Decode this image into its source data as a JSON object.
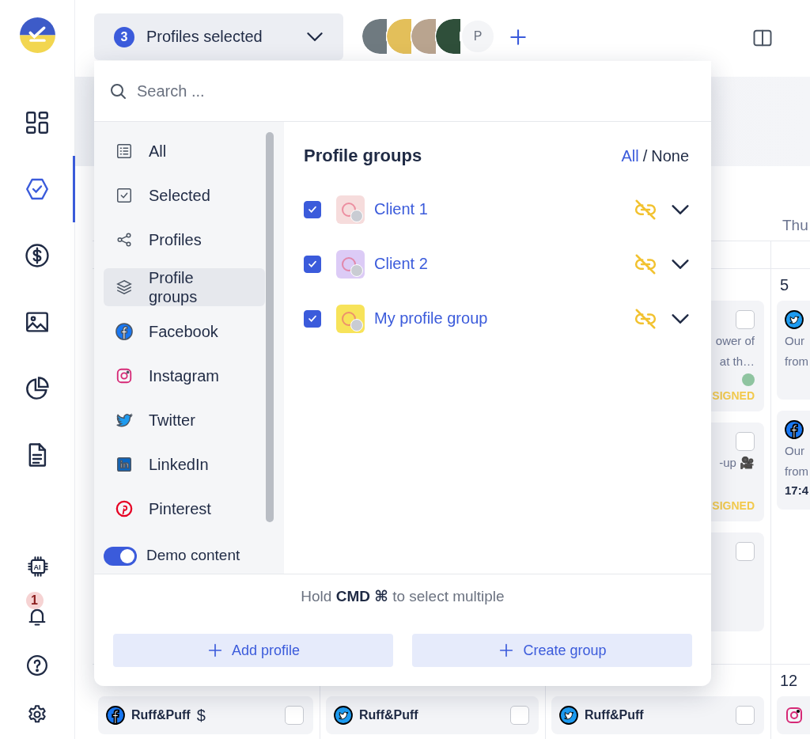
{
  "sidebar": {
    "items": [
      {
        "selected": false
      },
      {
        "selected": true
      },
      {
        "selected": false
      },
      {
        "selected": false
      },
      {
        "selected": false
      },
      {
        "selected": false
      }
    ],
    "ai_label": "AI",
    "notification_badge": "1"
  },
  "topbar": {
    "profile_selector": {
      "count": "3",
      "label": "Profiles selected",
      "expanded": true
    },
    "avatars": [
      {
        "kind": "photo"
      },
      {
        "kind": "photo"
      },
      {
        "kind": "photo"
      },
      {
        "kind": "photo"
      },
      {
        "kind": "initial",
        "text": "P"
      }
    ]
  },
  "dropdown": {
    "search": {
      "placeholder": "Search ..."
    },
    "categories": [
      {
        "label": "All",
        "selected": false
      },
      {
        "label": "Selected",
        "selected": false
      },
      {
        "label": "Profiles",
        "selected": false
      },
      {
        "label": "Profile groups",
        "selected": true
      },
      {
        "label": "Facebook",
        "selected": false
      },
      {
        "label": "Instagram",
        "selected": false
      },
      {
        "label": "Twitter",
        "selected": false
      },
      {
        "label": "LinkedIn",
        "selected": false
      },
      {
        "label": "Pinterest",
        "selected": false
      }
    ],
    "demo_toggle": {
      "label": "Demo content",
      "on": true
    },
    "heading": "Profile groups",
    "select_all": "All",
    "separator": "/",
    "select_none": "None",
    "groups": [
      {
        "name": "Client 1",
        "checked": true,
        "color": "#f6dcdc"
      },
      {
        "name": "Client 2",
        "checked": true,
        "color": "#dccbf6"
      },
      {
        "name": "My profile group",
        "checked": true,
        "color": "#f7e35a"
      }
    ],
    "hint": "Hold **CMD ⌘** to select multiple",
    "buttons": [
      {
        "label": "Add profile"
      },
      {
        "label": "Create group"
      }
    ]
  },
  "calendar": {
    "weekday": "Thu",
    "weeks": [
      {
        "days": [
          {
            "posts": [
              {
                "kind": "none",
                "checked": false,
                "lines": [
                  "ower of",
                  "at th…"
                ],
                "color": "#8fc4a0",
                "status": "SIGNED"
              },
              {
                "kind": "none",
                "checked": false,
                "lines": [
                  "-up 🎥"
                ],
                "status": "SIGNED"
              },
              {
                "kind": "none",
                "checked": false
              }
            ]
          },
          {
            "date": "5",
            "posts": [
              {
                "kind": "twitter",
                "lines": [
                  "Our",
                  "from"
                ]
              },
              {
                "kind": "facebook",
                "lines": [
                  "Our",
                  "from"
                ],
                "time": "17:4"
              }
            ]
          }
        ]
      },
      {
        "days": [
          {
            "posts": [
              {
                "kind": "facebook",
                "author": "Ruff&Puff",
                "extra": "$",
                "checked": false
              }
            ]
          },
          {
            "posts": [
              {
                "kind": "twitter",
                "author": "Ruff&Puff",
                "checked": false
              }
            ]
          },
          {
            "posts": [
              {
                "kind": "twitter",
                "author": "Ruff&Puff",
                "checked": false
              }
            ]
          },
          {
            "date": "12",
            "posts": [
              {
                "kind": "instagram"
              }
            ]
          }
        ]
      }
    ]
  }
}
